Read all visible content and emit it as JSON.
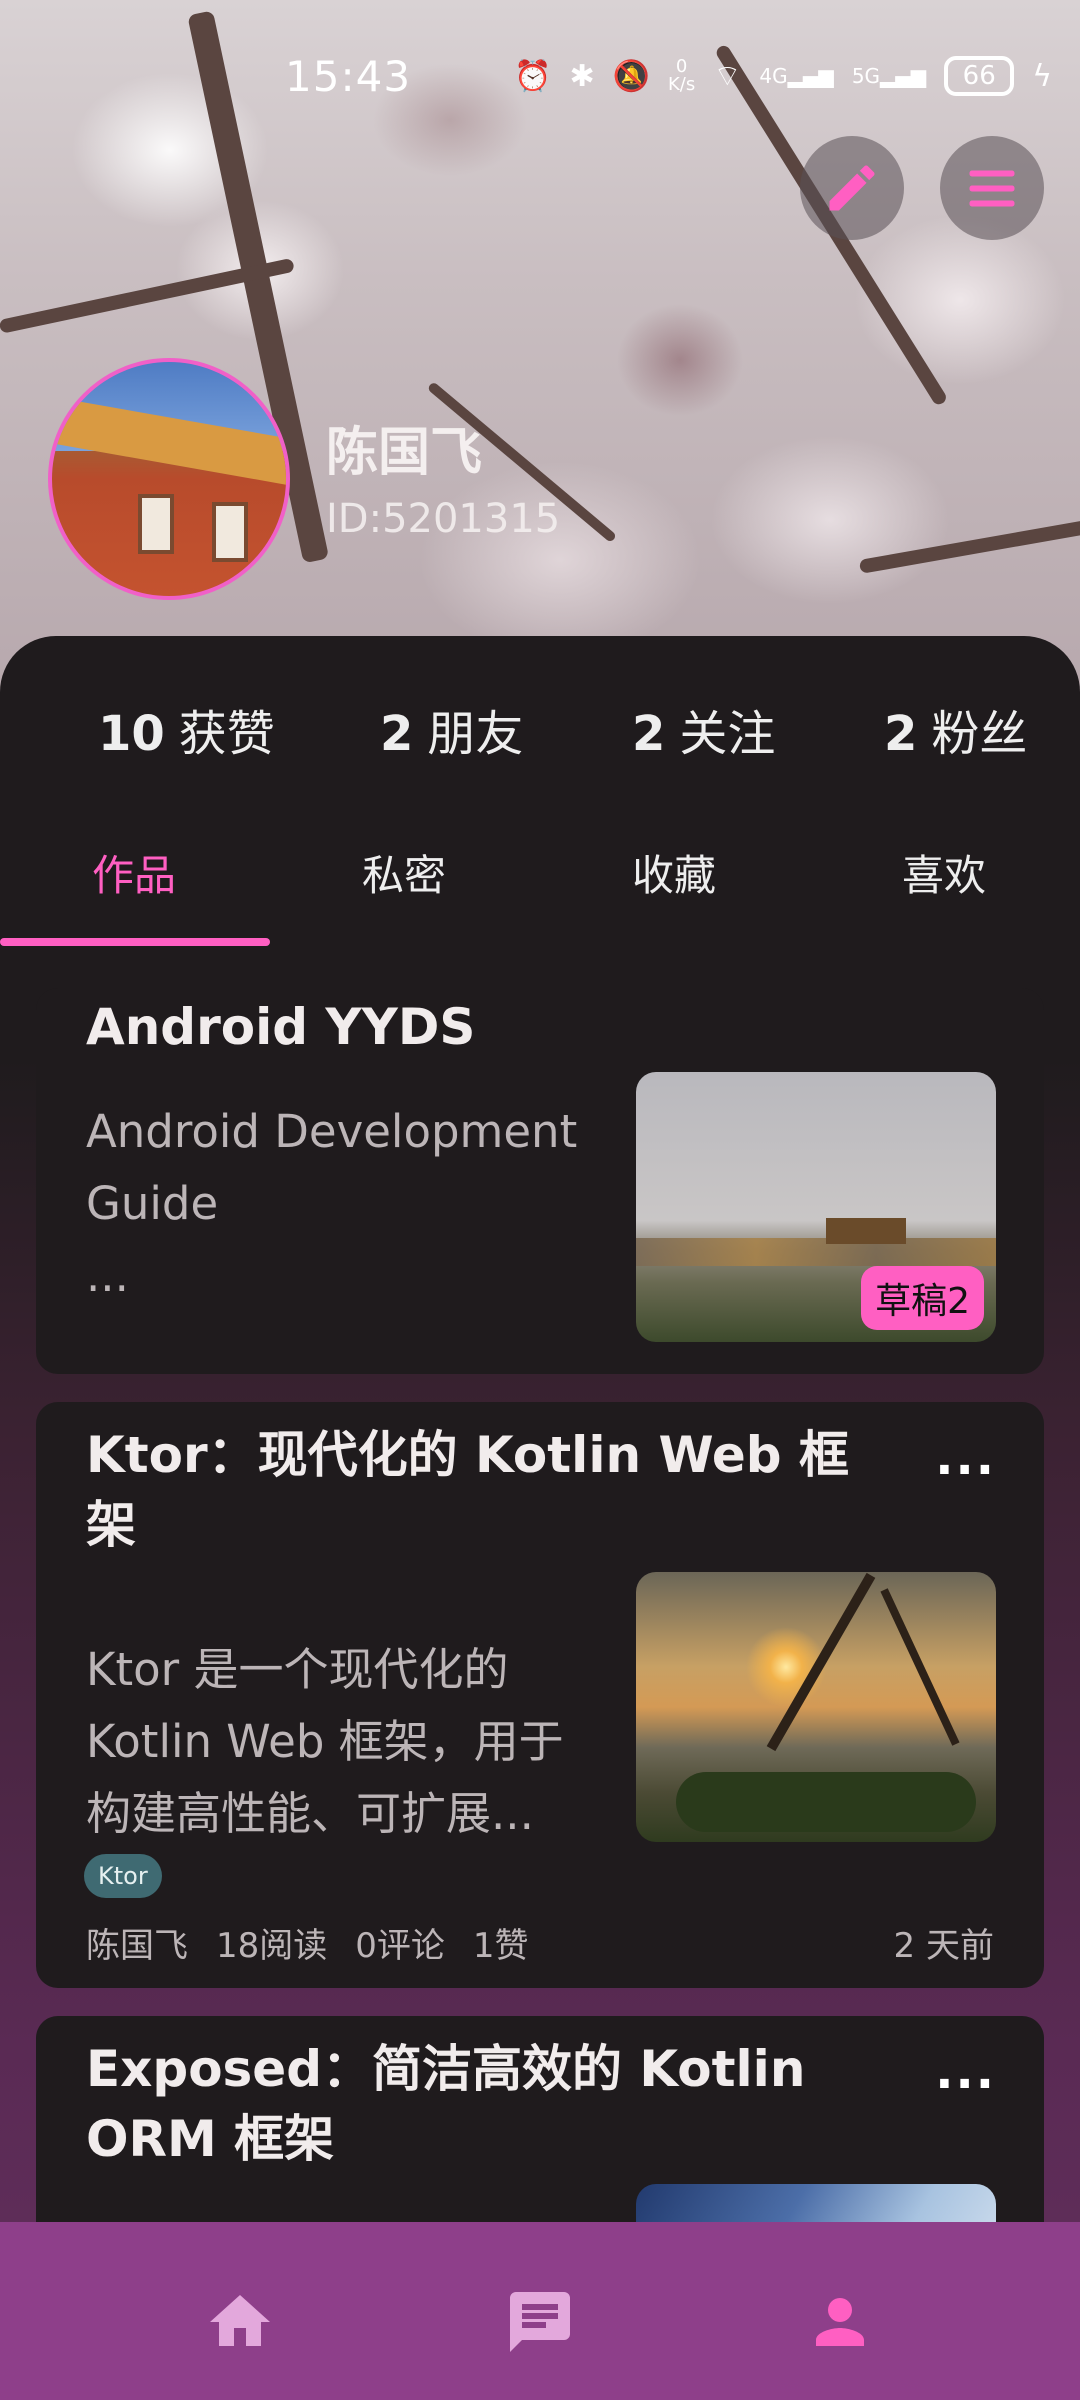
{
  "status_bar": {
    "time": "15:43",
    "net_speed_top": "0",
    "net_speed_unit": "K/s",
    "net1": "4G",
    "net2": "5G",
    "battery": "66"
  },
  "profile": {
    "name": "陈国飞",
    "id_text": "ID:5201315"
  },
  "stats": [
    {
      "count": "10",
      "label": "获赞"
    },
    {
      "count": "2",
      "label": "朋友"
    },
    {
      "count": "2",
      "label": "关注"
    },
    {
      "count": "2",
      "label": "粉丝"
    }
  ],
  "tabs": [
    {
      "label": "作品",
      "active": true
    },
    {
      "label": "私密",
      "active": false
    },
    {
      "label": "收藏",
      "active": false
    },
    {
      "label": "喜欢",
      "active": false
    }
  ],
  "cards": [
    {
      "title": "Android YYDS",
      "summary": "Android Development Guide",
      "ellipsis": "...",
      "badge": "草稿2"
    },
    {
      "title": "Ktor：现代化的 Kotlin Web 框架",
      "summary": "Ktor 是一个现代化的 Kotlin Web 框架，用于构建高性能、可扩展...",
      "more": "...",
      "tag": "Ktor",
      "author": "陈国飞",
      "reads": "18阅读",
      "comments": "0评论",
      "likes": "1赞",
      "time_ago": "2 天前"
    },
    {
      "title": "Exposed：简洁高效的 Kotlin ORM 框架",
      "more": "..."
    }
  ],
  "colors": {
    "accent": "#ff5fc2",
    "nav_bg": "#8e3f8a",
    "card_bg": "#1f1b1d"
  },
  "icons": {
    "edit": "pencil-icon",
    "menu": "hamburger-menu-icon",
    "nav_home": "home-icon",
    "nav_messages": "chat-icon",
    "nav_profile": "person-icon"
  }
}
